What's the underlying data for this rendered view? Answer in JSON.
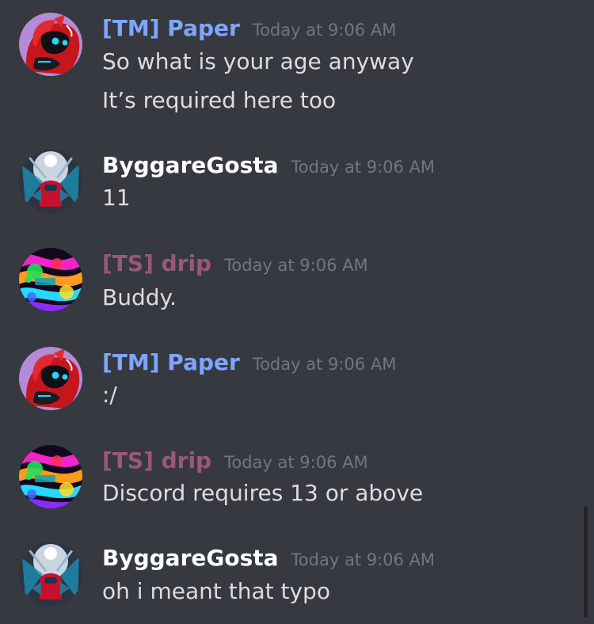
{
  "colors": {
    "background": "#36393f",
    "tm_role": "#7ea6ff",
    "ts_role": "#9a5878",
    "default_name": "#ffffff",
    "message_text": "#dcddde",
    "timestamp": "#72767d"
  },
  "messages": [
    {
      "author": "[TM] Paper",
      "avatar_icon": "red-protogen-avatar",
      "timestamp": "Today at 9:06 AM",
      "lines": [
        "So what is your age anyway",
        "It’s required here too"
      ]
    },
    {
      "author": "ByggareGosta",
      "avatar_icon": "among-us-avatar",
      "timestamp": "Today at 9:06 AM",
      "lines": [
        "11"
      ]
    },
    {
      "author": "[TS] drip",
      "avatar_icon": "neon-swirl-avatar",
      "timestamp": "Today at 9:06 AM",
      "lines": [
        "Buddy."
      ]
    },
    {
      "author": "[TM] Paper",
      "avatar_icon": "red-protogen-avatar",
      "timestamp": "Today at 9:06 AM",
      "lines": [
        ":/"
      ]
    },
    {
      "author": "[TS] drip",
      "avatar_icon": "neon-swirl-avatar",
      "timestamp": "Today at 9:06 AM",
      "lines": [
        "Discord requires 13 or above"
      ]
    },
    {
      "author": "ByggareGosta",
      "avatar_icon": "among-us-avatar",
      "timestamp": "Today at 9:06 AM",
      "lines": [
        "oh i meant that typo"
      ]
    }
  ]
}
